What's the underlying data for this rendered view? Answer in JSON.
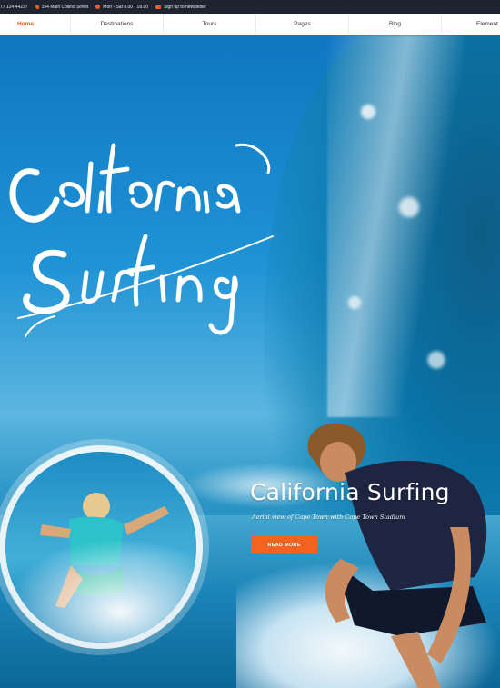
{
  "topbar": {
    "phone": "77 124 44227",
    "address": "154 Main Collins Street",
    "hours": "Mon - Sat 8.00 - 18.00",
    "newsletter": "Sign up to newsletter"
  },
  "nav": {
    "items": [
      {
        "label": "Home"
      },
      {
        "label": "Destinations"
      },
      {
        "label": "Tours"
      },
      {
        "label": "Pages"
      },
      {
        "label": "Blog"
      },
      {
        "label": "Element"
      }
    ]
  },
  "hero": {
    "script_logo": "California Surfing",
    "title": "California Surfing",
    "subtitle": "Aerial view of Cape Town with Cape Town Stadium",
    "button": "READ MORE"
  },
  "colors": {
    "accent": "#f26322",
    "topbar_bg": "#1f2530"
  },
  "icons": [
    "phone-icon",
    "location-pin-icon",
    "clock-icon",
    "mail-icon"
  ]
}
